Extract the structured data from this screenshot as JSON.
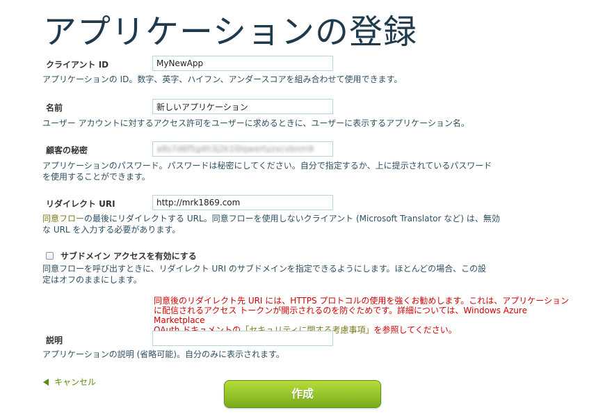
{
  "page": {
    "title": "アプリケーションの登録"
  },
  "client_id": {
    "label": "クライアント ID",
    "value": "MyNewApp",
    "description": "アプリケーションの ID。数字、英字、ハイフン、アンダースコアを組み合わせて使用できます。"
  },
  "name": {
    "label": "名前",
    "value": "新しいアプリケーション",
    "description": "ユーザー アカウントに対するアクセス許可をユーザーに求めるときに、ユーザーに表示するアプリケーション名。"
  },
  "client_secret": {
    "label": "顧客の秘密",
    "value": "a8s7d6f5g4h3j2k1l0qwertyzxcvbnm9",
    "description_line1": "アプリケーションのパスワード。パスワードは秘密にしてください。自分で指定するか、上に提示されているパスワード",
    "description_line2": "を使用することができます。"
  },
  "redirect_uri": {
    "label": "リダイレクト URI",
    "value": "http://mrk1869.com",
    "description_accent": "同意フロー",
    "description_line1_rest": "の最後にリダイレクトする URL。同意フローを使用しないクライアント (Microsoft Translator など) は、無効",
    "description_line2": "な URL を入力する必要があります。"
  },
  "subdomain_access": {
    "label": "サブドメイン アクセスを有効にする",
    "checked": false,
    "description_line1": "同意フローを呼び出すときに、リダイレクト URI のサブドメインを指定できるようにします。ほとんどの場合、この設",
    "description_line2": "定はオフのままにします。"
  },
  "warning": {
    "line1": "同意後のリダイレクト先 URI には、HTTPS プロトコルの使用を強くお勧めします。これは、アプリケーション",
    "line2": "に配信されるアクセス トークンが開示されるのを防ぐためです。詳細については、Windows Azure Marketplace",
    "line3_pre": "OAuth ドキュメントの",
    "line3_accent": "「セキュリティに関する考慮事項」",
    "line3_post": "を参照してください。"
  },
  "description_field": {
    "label": "説明",
    "value": "",
    "description": "アプリケーションの説明 (省略可能)。自分のみに表示されます。"
  },
  "actions": {
    "cancel_label": "キャンセル",
    "create_label": "作成"
  },
  "colors": {
    "accent_green": "#78ac1c",
    "warning_red": "#d40000",
    "title": "#1f3a4c"
  }
}
